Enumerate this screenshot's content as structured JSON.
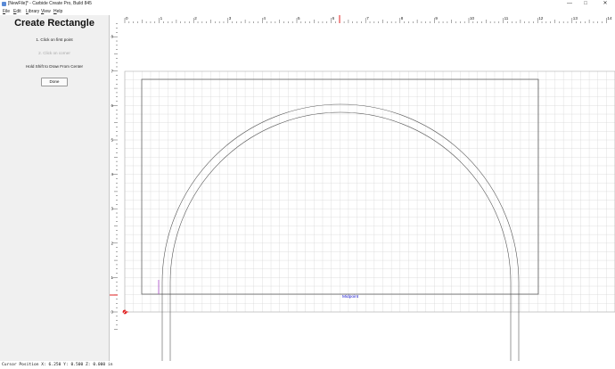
{
  "window": {
    "title": "[NewFile]* - Carbide Create Pro, Build 845",
    "minimize_glyph": "—",
    "maximize_glyph": "□",
    "close_glyph": "✕"
  },
  "menu": {
    "items": [
      "File",
      "Edit",
      "Library",
      "View",
      "Help"
    ]
  },
  "panel": {
    "heading": "Create Rectangle",
    "step1": "1. Click on first point",
    "step2": "2. Click on corner",
    "hint": "Hold Shift to Draw From Center",
    "done_label": "Done"
  },
  "rulers": {
    "top_labels": [
      "0",
      "1",
      "2",
      "3",
      "4",
      "5",
      "6",
      "7",
      "8",
      "9",
      "10",
      "11",
      "12",
      "13",
      "14"
    ],
    "left_labels": [
      "8",
      "7",
      "6",
      "5",
      "4",
      "3",
      "2",
      "1",
      "0"
    ],
    "cursor_marker_color": "#e02020"
  },
  "canvas": {
    "snap_label": "Midpoint",
    "snap_label_color": "#2020d0",
    "grid_color": "#d8d8d8",
    "geometry_color": "#555555",
    "origin_icon": "origin-axes-icon"
  },
  "status": {
    "text": "Cursor Position X: 6.250 Y: 0.500 Z: 0.000 in"
  }
}
